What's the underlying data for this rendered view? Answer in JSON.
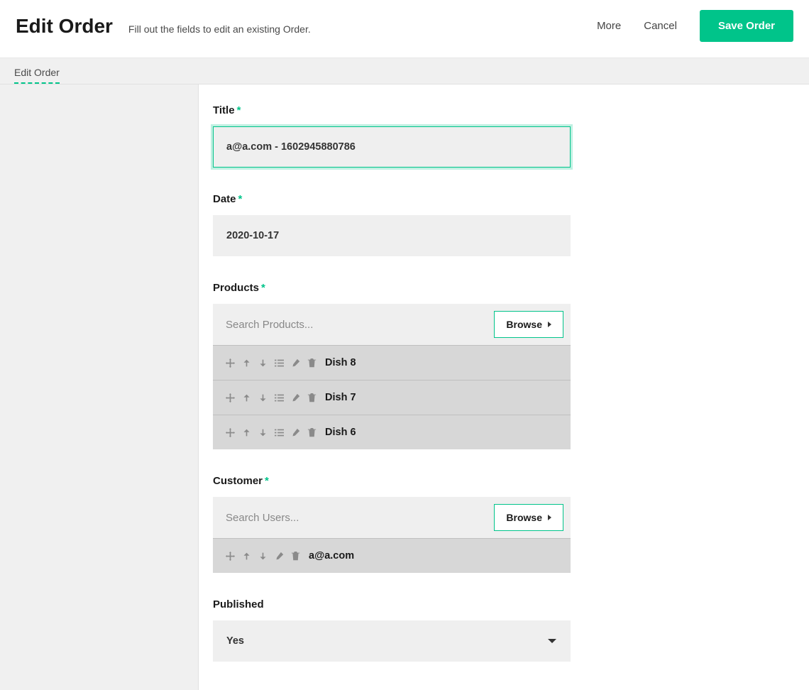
{
  "header": {
    "title": "Edit Order",
    "description": "Fill out the fields to edit an existing Order.",
    "more": "More",
    "cancel": "Cancel",
    "save": "Save Order"
  },
  "tab": {
    "label": "Edit Order"
  },
  "fields": {
    "title": {
      "label": "Title",
      "value": "a@a.com - 1602945880786",
      "required": true
    },
    "date": {
      "label": "Date",
      "value": "2020-10-17",
      "required": true
    },
    "products": {
      "label": "Products",
      "required": true,
      "search_placeholder": "Search Products...",
      "browse": "Browse",
      "items": [
        {
          "label": "Dish 8"
        },
        {
          "label": "Dish 7"
        },
        {
          "label": "Dish 6"
        }
      ]
    },
    "customer": {
      "label": "Customer",
      "required": true,
      "search_placeholder": "Search Users...",
      "browse": "Browse",
      "items": [
        {
          "label": "a@a.com"
        }
      ]
    },
    "published": {
      "label": "Published",
      "value": "Yes"
    }
  }
}
